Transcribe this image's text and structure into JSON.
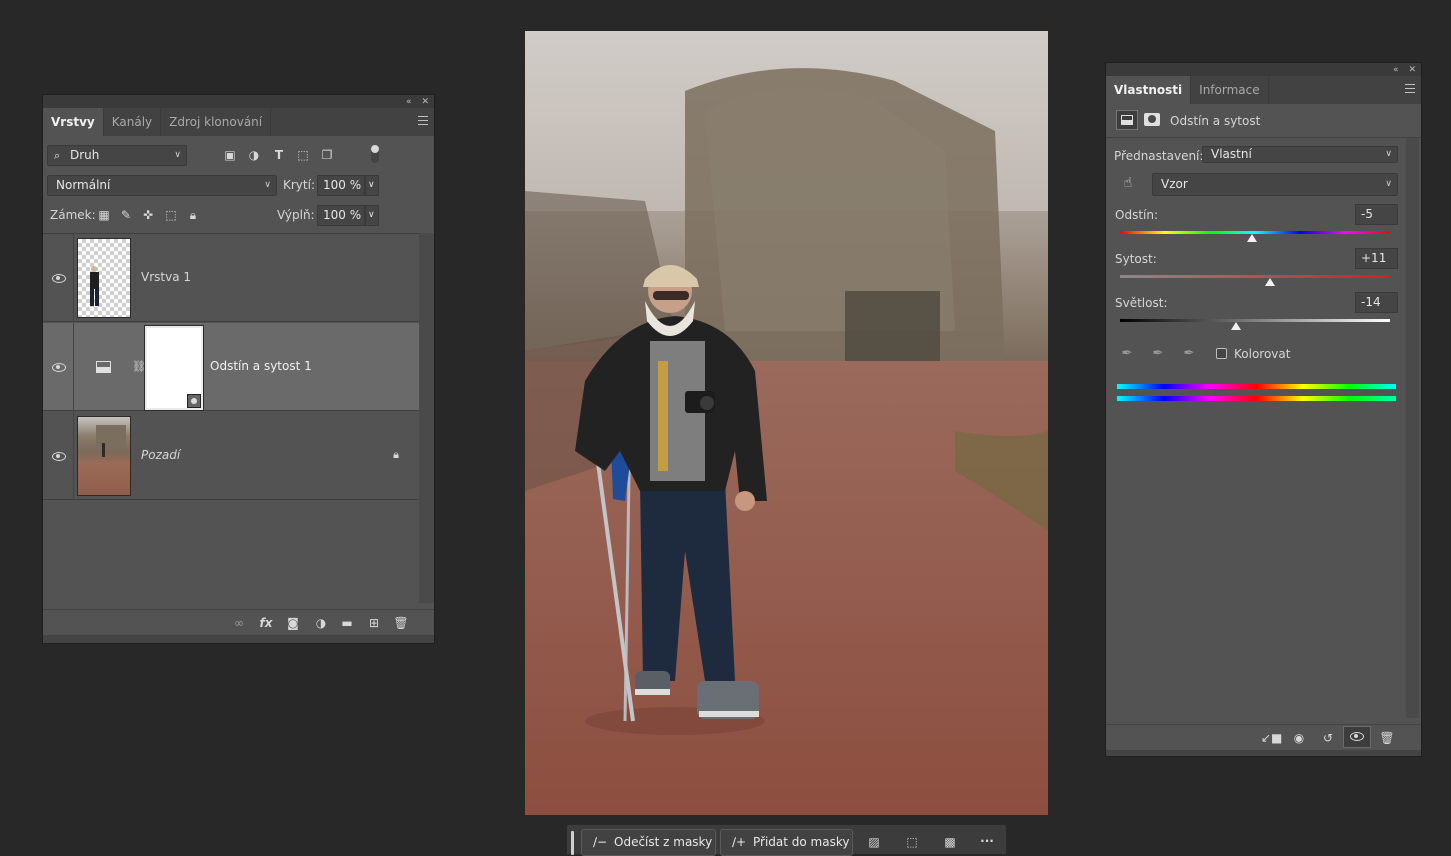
{
  "layers_panel": {
    "tabs": [
      "Vrstvy",
      "Kanály",
      "Zdroj klonování"
    ],
    "filter_kind": "Druh",
    "blend_mode": "Normální",
    "opacity_label": "Krytí:",
    "opacity_value": "100 %",
    "lock_label": "Zámek:",
    "fill_label": "Výplň:",
    "fill_value": "100 %",
    "layers": [
      {
        "name": "Vrstva 1",
        "visible": true
      },
      {
        "name": "Odstín a sytost 1",
        "visible": true,
        "selected": true
      },
      {
        "name": "Pozadí",
        "visible": true,
        "locked": true
      }
    ],
    "footer_fx": "fx"
  },
  "properties_panel": {
    "tabs": [
      "Vlastnosti",
      "Informace"
    ],
    "header_title": "Odstín a sytost",
    "preset_label": "Přednastavení:",
    "preset_value": "Vlastní",
    "channel_value": "Vzor",
    "hue_label": "Odstín:",
    "hue_value": "-5",
    "hue_level": 0.49,
    "saturation_label": "Sytost:",
    "saturation_value": "+11",
    "saturation_level": 0.555,
    "lightness_label": "Světlost:",
    "lightness_value": "-14",
    "lightness_level": 0.43,
    "colorize_label": "Kolorovat",
    "colorize_checked": false
  },
  "context_bar": {
    "subtract_label": "Odečíst z masky",
    "add_label": "Přidat do masky",
    "more_label": "···"
  },
  "colors": {
    "panel_bg": "#535353",
    "app_bg": "#282828",
    "accent_red": "#d21f1f"
  }
}
